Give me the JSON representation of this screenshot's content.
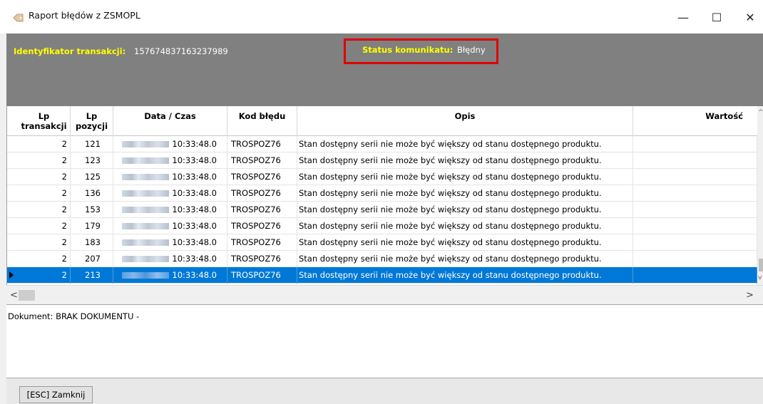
{
  "window": {
    "title": "Raport błędów z ZSMOPL",
    "minimize_glyph": "—",
    "maximize_glyph": "☐",
    "close_glyph": "✕"
  },
  "header": {
    "transaction_label": "Identyfikator transakcji:",
    "transaction_value": "157674837163237989",
    "status_label": "Status komunikatu:",
    "status_value": "Błędny",
    "highlight_color": "#e00000",
    "label_color": "#ffff00",
    "panel_color": "#808080"
  },
  "table": {
    "columns": [
      {
        "label": "Lp\ntransakcji"
      },
      {
        "label": "Lp\npozycji"
      },
      {
        "label": "Data / Czas"
      },
      {
        "label": "Kod błędu"
      },
      {
        "label": "Opis"
      },
      {
        "label": "Wartość"
      }
    ],
    "rows": [
      {
        "lp_trans": "2",
        "lp_poz": "121",
        "time": "10:33:48.0",
        "kod": "TROSPOZ76",
        "opis": "Stan dostępny serii nie może być większy od stanu dostępnego produktu.",
        "wartosc": ""
      },
      {
        "lp_trans": "2",
        "lp_poz": "123",
        "time": "10:33:48.0",
        "kod": "TROSPOZ76",
        "opis": "Stan dostępny serii nie może być większy od stanu dostępnego produktu.",
        "wartosc": ""
      },
      {
        "lp_trans": "2",
        "lp_poz": "125",
        "time": "10:33:48.0",
        "kod": "TROSPOZ76",
        "opis": "Stan dostępny serii nie może być większy od stanu dostępnego produktu.",
        "wartosc": ""
      },
      {
        "lp_trans": "2",
        "lp_poz": "136",
        "time": "10:33:48.0",
        "kod": "TROSPOZ76",
        "opis": "Stan dostępny serii nie może być większy od stanu dostępnego produktu.",
        "wartosc": ""
      },
      {
        "lp_trans": "2",
        "lp_poz": "153",
        "time": "10:33:48.0",
        "kod": "TROSPOZ76",
        "opis": "Stan dostępny serii nie może być większy od stanu dostępnego produktu.",
        "wartosc": ""
      },
      {
        "lp_trans": "2",
        "lp_poz": "179",
        "time": "10:33:48.0",
        "kod": "TROSPOZ76",
        "opis": "Stan dostępny serii nie może być większy od stanu dostępnego produktu.",
        "wartosc": ""
      },
      {
        "lp_trans": "2",
        "lp_poz": "183",
        "time": "10:33:48.0",
        "kod": "TROSPOZ76",
        "opis": "Stan dostępny serii nie może być większy od stanu dostępnego produktu.",
        "wartosc": ""
      },
      {
        "lp_trans": "2",
        "lp_poz": "207",
        "time": "10:33:48.0",
        "kod": "TROSPOZ76",
        "opis": "Stan dostępny serii nie może być większy od stanu dostępnego produktu.",
        "wartosc": ""
      },
      {
        "lp_trans": "2",
        "lp_poz": "213",
        "time": "10:33:48.0",
        "kod": "TROSPOZ76",
        "opis": "Stan dostępny serii nie może być większy od stanu dostępnego produktu.",
        "wartosc": "",
        "selected": true
      }
    ],
    "selected_color": "#0078d7"
  },
  "scroll": {
    "left_arrow": "<",
    "right_arrow": ">"
  },
  "document": {
    "text": "Dokument: BRAK DOKUMENTU -"
  },
  "footer": {
    "close_label": "[ESC] Zamknij"
  }
}
